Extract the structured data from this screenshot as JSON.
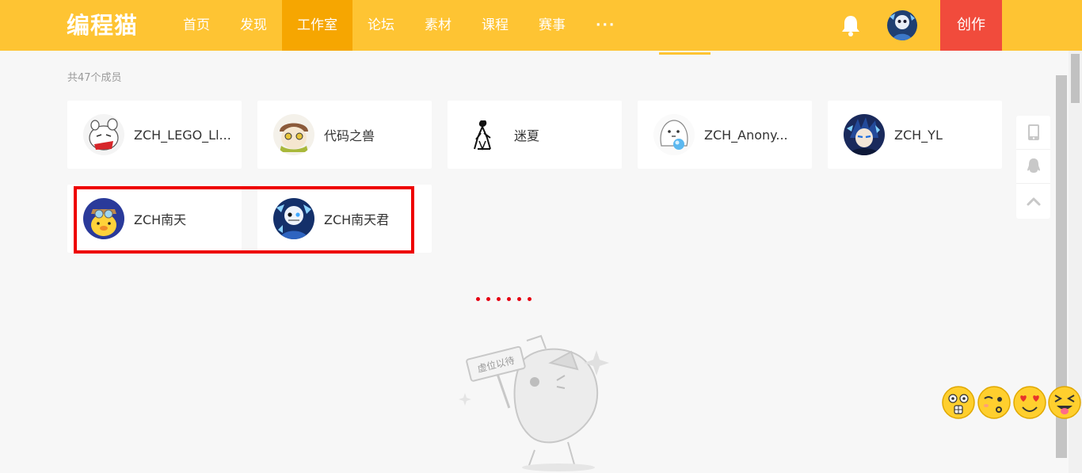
{
  "header": {
    "logo": "编程猫",
    "nav": [
      {
        "label": "首页",
        "active": false
      },
      {
        "label": "发现",
        "active": false
      },
      {
        "label": "工作室",
        "active": true
      },
      {
        "label": "论坛",
        "active": false
      },
      {
        "label": "素材",
        "active": false
      },
      {
        "label": "课程",
        "active": false
      },
      {
        "label": "赛事",
        "active": false
      }
    ],
    "more_label": "···",
    "create_label": "创作",
    "icons": {
      "notification": "bell-icon",
      "user": "avatar"
    },
    "colors": {
      "bar": "#fec433",
      "active_tab": "#f6a601",
      "create": "#f14b3c"
    }
  },
  "members": {
    "count_text": "共47个成员",
    "list": [
      {
        "name": "ZCH_LEGO_Ll...",
        "avatar": "white-cartoon-creature"
      },
      {
        "name": "代码之兽",
        "avatar": "pilot-cat"
      },
      {
        "name": "迷夏",
        "avatar": "ink-sketch-figure"
      },
      {
        "name": "ZCH_Anony...",
        "avatar": "white-ghost-with-orb"
      },
      {
        "name": "ZCH_YL",
        "avatar": "blue-anime-character"
      },
      {
        "name": "ZCH南天",
        "avatar": "yellow-mascot-with-goggles"
      },
      {
        "name": "ZCH南天君",
        "avatar": "blue-skeleton-character"
      }
    ],
    "highlight_color": "#ee0000"
  },
  "loading": {
    "dot_color": "#e60012",
    "placeholder_sign": "虚位以待"
  },
  "side_tools": [
    "phone-icon",
    "qq-icon",
    "back-to-top-icon"
  ],
  "emoji_pet": [
    "surprised-face-icon",
    "winking-face-icon",
    "heart-eyes-face-icon",
    "squinting-tongue-face-icon"
  ]
}
